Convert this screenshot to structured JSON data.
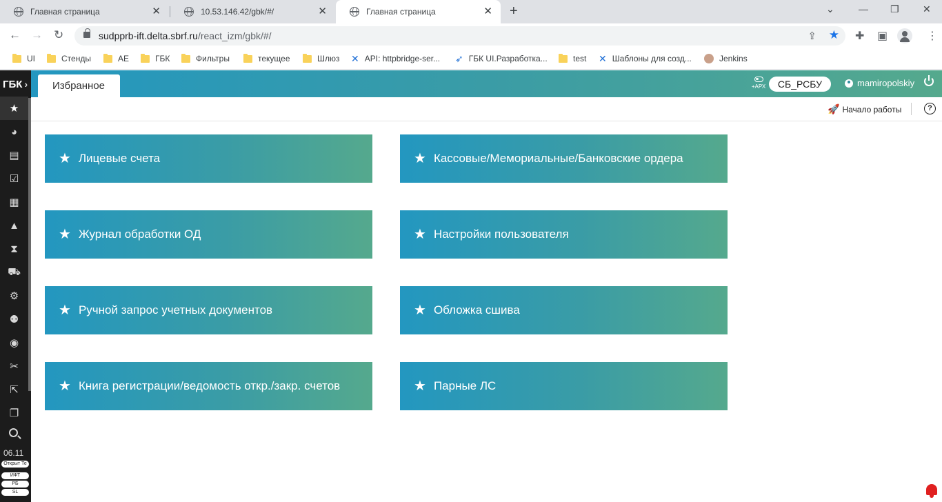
{
  "browser": {
    "tabs": [
      {
        "title": "Главная страница",
        "active": false
      },
      {
        "title": "10.53.146.42/gbk/#/",
        "active": false
      },
      {
        "title": "Главная страница",
        "active": true
      }
    ],
    "url_host": "sudpprb-ift.delta.sbrf.ru",
    "url_path": "/react_izm/gbk/#/",
    "bookmarks": [
      {
        "label": "UI",
        "icon": "folder-icon"
      },
      {
        "label": "Стенды",
        "icon": "folder-icon"
      },
      {
        "label": "AE",
        "icon": "folder-icon"
      },
      {
        "label": "ГБК",
        "icon": "folder-icon"
      },
      {
        "label": "Фильтры",
        "icon": "folder-icon"
      },
      {
        "label": "текущее",
        "icon": "folder-icon"
      },
      {
        "label": "Шлюз",
        "icon": "folder-icon"
      },
      {
        "label": "API: httpbridge-ser...",
        "icon": "confluence-icon"
      },
      {
        "label": "ГБК UI.Разработка...",
        "icon": "jira-icon"
      },
      {
        "label": "test",
        "icon": "folder-icon"
      },
      {
        "label": "Шаблоны для созд...",
        "icon": "confluence-icon"
      },
      {
        "label": "Jenkins",
        "icon": "jenkins-icon"
      }
    ]
  },
  "sidebar": {
    "title": "ГБК",
    "items": [
      {
        "name": "favorites",
        "icon": "star-icon",
        "active": true
      },
      {
        "name": "reports",
        "icon": "pie-chart-icon"
      },
      {
        "name": "calendar",
        "icon": "calendar-icon"
      },
      {
        "name": "calendar-check",
        "icon": "calendar-check-icon"
      },
      {
        "name": "calendar-grid",
        "icon": "calendar-grid-icon"
      },
      {
        "name": "road",
        "icon": "road-icon"
      },
      {
        "name": "hourglass",
        "icon": "hourglass-icon"
      },
      {
        "name": "delivery",
        "icon": "truck-loading-icon"
      },
      {
        "name": "settings",
        "icon": "gear-icon"
      },
      {
        "name": "user-settings",
        "icon": "user-gear-icon"
      },
      {
        "name": "profile",
        "icon": "user-circle-icon"
      },
      {
        "name": "tools",
        "icon": "tools-icon"
      },
      {
        "name": "external",
        "icon": "external-link-icon"
      },
      {
        "name": "docs",
        "icon": "book-open-icon"
      }
    ],
    "date": "06.11",
    "pills": [
      "Открыт Те",
      "ИФТ",
      "РБ",
      "SL"
    ]
  },
  "header": {
    "tab_label": "Избранное",
    "arx_label": "+АРХ",
    "org": "СБ_РСБУ",
    "username": "mamiropolskiy"
  },
  "subbar": {
    "getting_started": "Начало работы",
    "help": "?"
  },
  "tiles": [
    "Лицевые счета",
    "Кассовые/Мемориальные/Банковские ордера",
    "Журнал обработки ОД",
    "Настройки пользователя",
    "Ручной запрос учетных документов",
    "Обложка сшива",
    "Книга регистрации/ведомость откр./закр. счетов",
    "Парные ЛС"
  ],
  "colors": {
    "accent_start": "#2397c0",
    "accent_end": "#55a98d",
    "sidebar_bg": "#1c1c1c",
    "bookmark_star": "#1a73e8",
    "notification": "#e02020"
  }
}
